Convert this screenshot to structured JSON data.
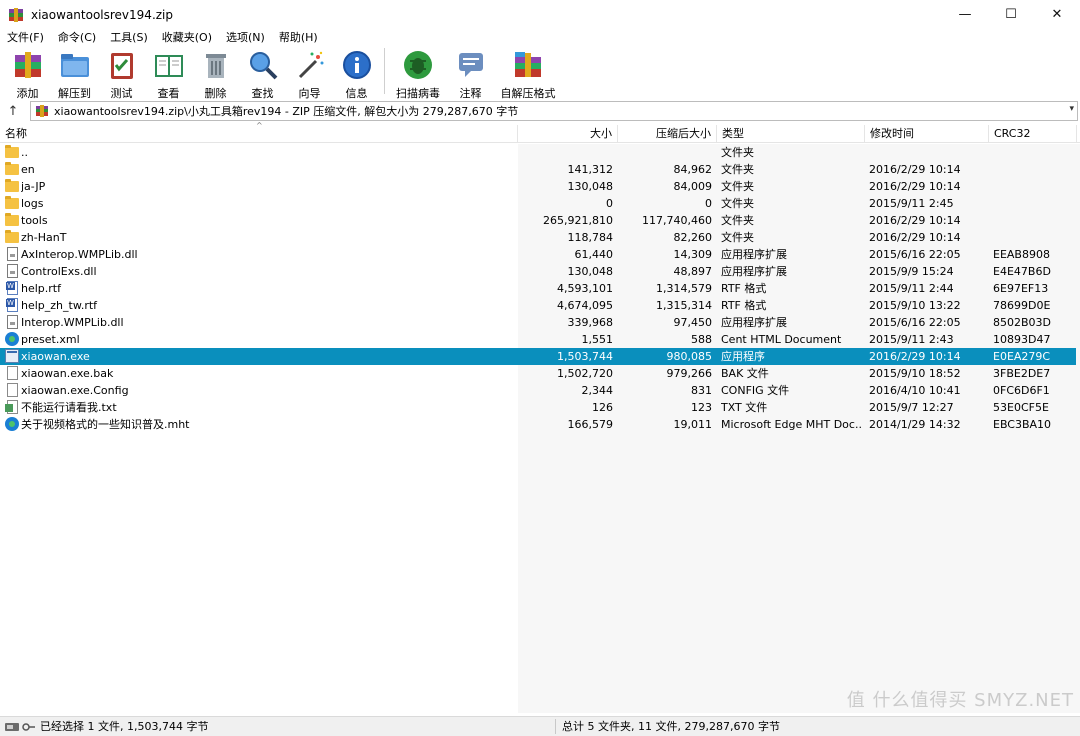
{
  "window": {
    "title": "xiaowantoolsrev194.zip",
    "minimize": "—",
    "maximize": "☐",
    "close": "✕"
  },
  "menu": [
    "文件(F)",
    "命令(C)",
    "工具(S)",
    "收藏夹(O)",
    "选项(N)",
    "帮助(H)"
  ],
  "toolbar": {
    "add": "添加",
    "extract": "解压到",
    "test": "测试",
    "view": "查看",
    "delete": "删除",
    "find": "查找",
    "wizard": "向导",
    "info": "信息",
    "virus_scan": "扫描病毒",
    "comment": "注释",
    "sfx": "自解压格式"
  },
  "address": {
    "path": "xiaowantoolsrev194.zip\\小丸工具箱rev194 - ZIP 压缩文件, 解包大小为 279,287,670 字节"
  },
  "columns": {
    "name": "名称",
    "size": "大小",
    "packed": "压缩后大小",
    "type": "类型",
    "modified": "修改时间",
    "crc": "CRC32"
  },
  "files": [
    {
      "name": "..",
      "size": "",
      "packed": "",
      "type": "文件夹",
      "modified": "",
      "crc": "",
      "icon": "folder"
    },
    {
      "name": "en",
      "size": "141,312",
      "packed": "84,962",
      "type": "文件夹",
      "modified": "2016/2/29 10:14",
      "crc": "",
      "icon": "folder"
    },
    {
      "name": "ja-JP",
      "size": "130,048",
      "packed": "84,009",
      "type": "文件夹",
      "modified": "2016/2/29 10:14",
      "crc": "",
      "icon": "folder"
    },
    {
      "name": "logs",
      "size": "0",
      "packed": "0",
      "type": "文件夹",
      "modified": "2015/9/11 2:45",
      "crc": "",
      "icon": "folder"
    },
    {
      "name": "tools",
      "size": "265,921,810",
      "packed": "117,740,460",
      "type": "文件夹",
      "modified": "2016/2/29 10:14",
      "crc": "",
      "icon": "folder"
    },
    {
      "name": "zh-HanT",
      "size": "118,784",
      "packed": "82,260",
      "type": "文件夹",
      "modified": "2016/2/29 10:14",
      "crc": "",
      "icon": "folder"
    },
    {
      "name": "AxInterop.WMPLib.dll",
      "size": "61,440",
      "packed": "14,309",
      "type": "应用程序扩展",
      "modified": "2015/6/16 22:05",
      "crc": "EEAB8908",
      "icon": "dll"
    },
    {
      "name": "ControlExs.dll",
      "size": "130,048",
      "packed": "48,897",
      "type": "应用程序扩展",
      "modified": "2015/9/9 15:24",
      "crc": "E4E47B6D",
      "icon": "dll"
    },
    {
      "name": "help.rtf",
      "size": "4,593,101",
      "packed": "1,314,579",
      "type": "RTF 格式",
      "modified": "2015/9/11 2:44",
      "crc": "6E97EF13",
      "icon": "rtf"
    },
    {
      "name": "help_zh_tw.rtf",
      "size": "4,674,095",
      "packed": "1,315,314",
      "type": "RTF 格式",
      "modified": "2015/9/10 13:22",
      "crc": "78699D0E",
      "icon": "rtf"
    },
    {
      "name": "Interop.WMPLib.dll",
      "size": "339,968",
      "packed": "97,450",
      "type": "应用程序扩展",
      "modified": "2015/6/16 22:05",
      "crc": "8502B03D",
      "icon": "dll"
    },
    {
      "name": "preset.xml",
      "size": "1,551",
      "packed": "588",
      "type": "Cent HTML Document",
      "modified": "2015/9/11 2:43",
      "crc": "10893D47",
      "icon": "edge"
    },
    {
      "name": "xiaowan.exe",
      "size": "1,503,744",
      "packed": "980,085",
      "type": "应用程序",
      "modified": "2016/2/29 10:14",
      "crc": "E0EA279C",
      "icon": "exe",
      "selected": true
    },
    {
      "name": "xiaowan.exe.bak",
      "size": "1,502,720",
      "packed": "979,266",
      "type": "BAK 文件",
      "modified": "2015/9/10 18:52",
      "crc": "3FBE2DE7",
      "icon": "file"
    },
    {
      "name": "xiaowan.exe.Config",
      "size": "2,344",
      "packed": "831",
      "type": "CONFIG 文件",
      "modified": "2016/4/10 10:41",
      "crc": "0FC6D6F1",
      "icon": "file"
    },
    {
      "name": "不能运行请看我.txt",
      "size": "126",
      "packed": "123",
      "type": "TXT 文件",
      "modified": "2015/9/7 12:27",
      "crc": "53E0CF5E",
      "icon": "txt"
    },
    {
      "name": "关于视频格式的一些知识普及.mht",
      "size": "166,579",
      "packed": "19,011",
      "type": "Microsoft Edge MHT Doc...",
      "modified": "2014/1/29 14:32",
      "crc": "EBC3BA10",
      "icon": "edge"
    }
  ],
  "status": {
    "left": "已经选择 1 文件, 1,503,744 字节",
    "right": "总计 5 文件夹, 11 文件, 279,287,670 字节"
  },
  "watermark": "值 什么值得买 SMYZ.NET",
  "colors": {
    "selection": "#0a8fbd",
    "folder": "#f5c242"
  }
}
